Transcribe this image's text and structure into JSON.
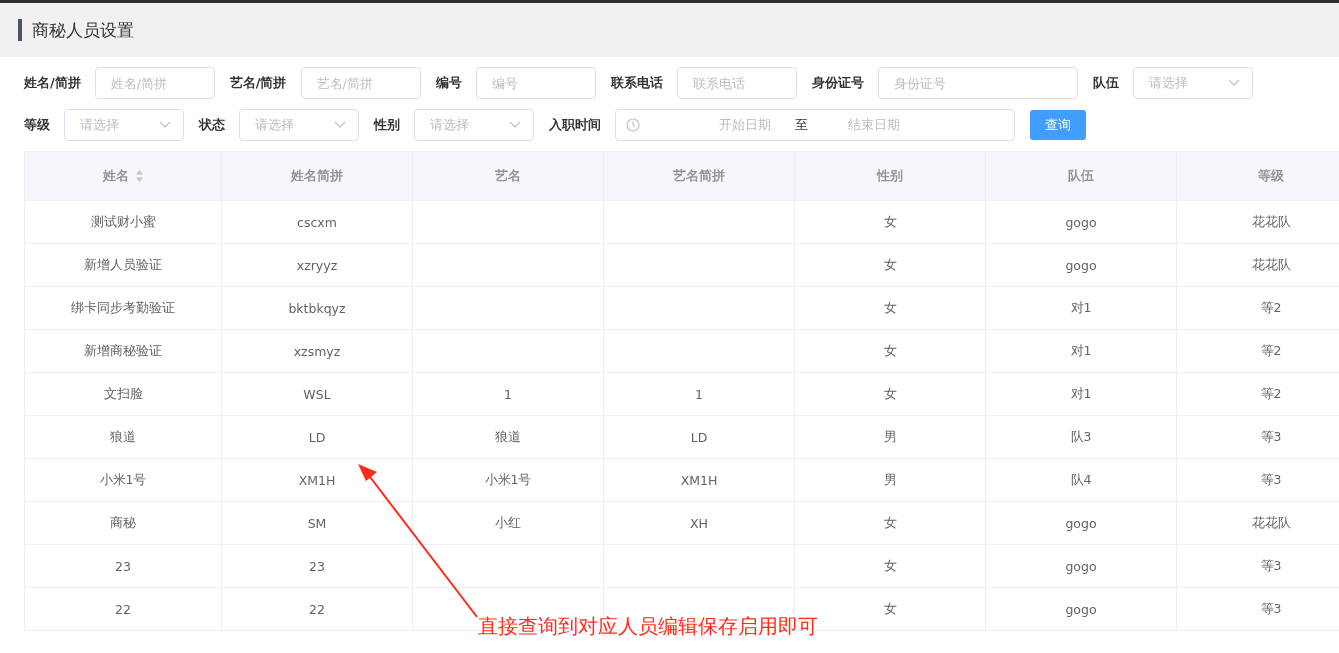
{
  "page_title": "商秘人员设置",
  "filter_rows": [
    [
      {
        "kind": "text",
        "label": "姓名/简拼",
        "placeholder": "姓名/简拼"
      },
      {
        "kind": "text",
        "label": "艺名/简拼",
        "placeholder": "艺名/简拼"
      },
      {
        "kind": "text",
        "label": "编号",
        "placeholder": "编号"
      },
      {
        "kind": "text",
        "label": "联系电话",
        "placeholder": "联系电话"
      },
      {
        "kind": "wide",
        "label": "身份证号",
        "placeholder": "身份证号"
      },
      {
        "kind": "select",
        "label": "队伍",
        "placeholder": "请选择"
      }
    ],
    [
      {
        "kind": "select",
        "label": "等级",
        "placeholder": "请选择"
      },
      {
        "kind": "select",
        "label": "状态",
        "placeholder": "请选择"
      },
      {
        "kind": "select",
        "label": "性别",
        "placeholder": "请选择"
      },
      {
        "kind": "daterange",
        "label": "入职时间",
        "start_placeholder": "开始日期",
        "separator": "至",
        "end_placeholder": "结束日期"
      }
    ]
  ],
  "query_button": "查询",
  "table": {
    "columns": [
      {
        "label": "姓名",
        "sortable": true
      },
      {
        "label": "姓名简拼",
        "sortable": false
      },
      {
        "label": "艺名",
        "sortable": false
      },
      {
        "label": "艺名简拼",
        "sortable": false
      },
      {
        "label": "性别",
        "sortable": false
      },
      {
        "label": "队伍",
        "sortable": false
      },
      {
        "label": "等级",
        "sortable": false
      }
    ],
    "rows": [
      [
        "测试财小蜜",
        "cscxm",
        "",
        "",
        "女",
        "gogo",
        "花花队"
      ],
      [
        "新增人员验证",
        "xzryyz",
        "",
        "",
        "女",
        "gogo",
        "花花队"
      ],
      [
        "绑卡同步考勤验证",
        "bktbkqyz",
        "",
        "",
        "女",
        "对1",
        "等2"
      ],
      [
        "新增商秘验证",
        "xzsmyz",
        "",
        "",
        "女",
        "对1",
        "等2"
      ],
      [
        "文扫脸",
        "WSL",
        "1",
        "1",
        "女",
        "对1",
        "等2"
      ],
      [
        "狼道",
        "LD",
        "狼道",
        "LD",
        "男",
        "队3",
        "等3"
      ],
      [
        "小米1号",
        "XM1H",
        "小米1号",
        "XM1H",
        "男",
        "队4",
        "等3"
      ],
      [
        "商秘",
        "SM",
        "小红",
        "XH",
        "女",
        "gogo",
        "花花队"
      ],
      [
        "23",
        "23",
        "",
        "",
        "女",
        "gogo",
        "等3"
      ],
      [
        "22",
        "22",
        "",
        "",
        "女",
        "gogo",
        "等3"
      ]
    ]
  },
  "annotation": "直接查询到对应人员编辑保存启用即可"
}
